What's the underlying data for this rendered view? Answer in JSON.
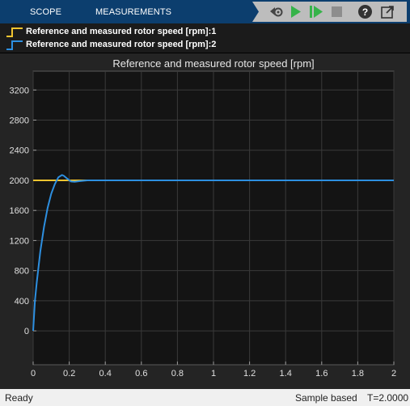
{
  "toolstrip": {
    "tabs": [
      {
        "label": "SCOPE"
      },
      {
        "label": "MEASUREMENTS"
      }
    ],
    "buttons": [
      {
        "icon": "step-back-settings-icon"
      },
      {
        "icon": "run-icon"
      },
      {
        "icon": "step-forward-icon"
      },
      {
        "icon": "stop-icon"
      },
      {
        "icon": "help-icon"
      },
      {
        "icon": "undock-icon"
      }
    ],
    "colors": {
      "bar": "#0c3e6e",
      "run_green": "#36b34a"
    }
  },
  "legend": {
    "entries": [
      {
        "label": "Reference and measured rotor speed [rpm]:1",
        "color": "#f2c430"
      },
      {
        "label": "Reference and measured rotor speed [rpm]:2",
        "color": "#2d8fe0"
      }
    ]
  },
  "chart_data": {
    "type": "line",
    "title": "Reference and measured rotor speed [rpm]",
    "xlim": [
      0,
      2
    ],
    "ylim": [
      -450,
      3450
    ],
    "x_ticks": [
      "0",
      "0.2",
      "0.4",
      "0.6",
      "0.8",
      "1",
      "1.2",
      "1.4",
      "1.6",
      "1.8",
      "2"
    ],
    "y_ticks": [
      "0",
      "400",
      "800",
      "1200",
      "1600",
      "2000",
      "2400",
      "2800",
      "3200"
    ],
    "grid": true,
    "series": [
      {
        "name": "Reference and measured rotor speed [rpm]:1",
        "color": "#f2c430",
        "x": [
          0,
          2
        ],
        "y": [
          2000,
          2000
        ]
      },
      {
        "name": "Reference and measured rotor speed [rpm]:2",
        "color": "#2d8fe0",
        "x": [
          0,
          0.01,
          0.02,
          0.04,
          0.06,
          0.08,
          0.1,
          0.12,
          0.14,
          0.16,
          0.17,
          0.19,
          0.21,
          0.23,
          0.26,
          0.3,
          0.35,
          0.4,
          0.6,
          0.8,
          1.0,
          1.2,
          1.4,
          1.6,
          1.8,
          2.0
        ],
        "y": [
          0,
          400,
          650,
          1060,
          1380,
          1630,
          1820,
          1950,
          2040,
          2070,
          2060,
          2020,
          1985,
          1980,
          1990,
          2000,
          2000,
          2000,
          2000,
          2000,
          2000,
          2000,
          2000,
          2000,
          2000,
          2000
        ]
      }
    ]
  },
  "status": {
    "left": "Ready",
    "mode": "Sample based",
    "time": "T=2.0000"
  }
}
